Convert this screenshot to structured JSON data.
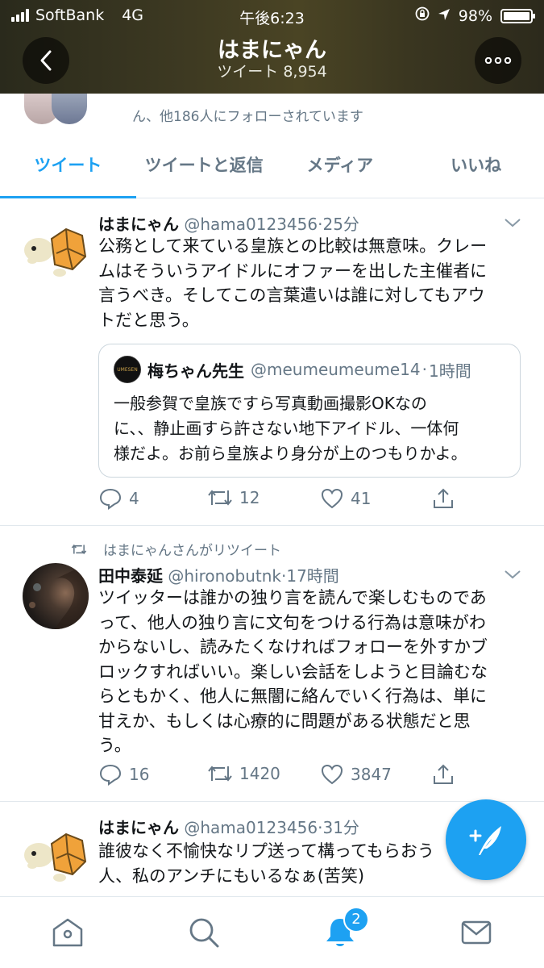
{
  "status_bar": {
    "carrier": "SoftBank",
    "network": "4G",
    "time": "午後6:23",
    "battery": "98%"
  },
  "header": {
    "title": "はまにゃん",
    "subtitle": "ツイート 8,954"
  },
  "followers": {
    "text": "ん、他186人にフォローされています"
  },
  "tabs": [
    {
      "label": "ツイート",
      "active": true
    },
    {
      "label": "ツイートと返信",
      "active": false
    },
    {
      "label": "メディア",
      "active": false
    },
    {
      "label": "いいね",
      "active": false
    }
  ],
  "tweets": [
    {
      "name": "はまにゃん",
      "handle": "@hama0123456",
      "time": "25分",
      "lines": [
        "公務として来ている皇族との比較は無意味。クレー",
        "ムはそういうアイドルにオファーを出した主催者に",
        "言うべき。そしてこの言葉遣いは誰に対してもアウ",
        "トだと思う。"
      ],
      "quote": {
        "name": "梅ちゃん先生",
        "handle": "@meumeumeume14",
        "time": "1時間",
        "avatar_text": "UMESEN",
        "lines": [
          "一般参賀で皇族ですら写真動画撮影OKなの",
          "に、、静止画すら許さない地下アイドル、一体何",
          "様だよ。お前ら皇族より身分が上のつもりかよ。"
        ]
      },
      "replies": "4",
      "retweets": "12",
      "likes": "41"
    },
    {
      "retweeted_by": "はまにゃんさんがリツイート",
      "name": "田中泰延",
      "handle": "@hironobutnk",
      "time": "17時間",
      "lines": [
        "ツイッターは誰かの独り言を読んで楽しむものであ",
        "って、他人の独り言に文句をつける行為は意味がわ",
        "からないし、読みたくなければフォローを外すかブ",
        "ロックすればいい。楽しい会話をしようと目論むな",
        "らともかく、他人に無闇に絡んでいく行為は、単に",
        "甘えか、もしくは心療的に問題がある状態だと思",
        "う。"
      ],
      "replies": "16",
      "retweets": "1420",
      "likes": "3847"
    },
    {
      "name": "はまにゃん",
      "handle": "@hama0123456",
      "time": "31分",
      "lines": [
        "誰彼なく不愉快なリプ送って構ってもらおう",
        "人、私のアンチにもいるなぁ(苦笑)"
      ]
    }
  ],
  "bottom_nav": {
    "notifications_badge": "2"
  },
  "colors": {
    "accent": "#1da1f2",
    "secondary_text": "#657786",
    "border": "#e1e8ed"
  }
}
